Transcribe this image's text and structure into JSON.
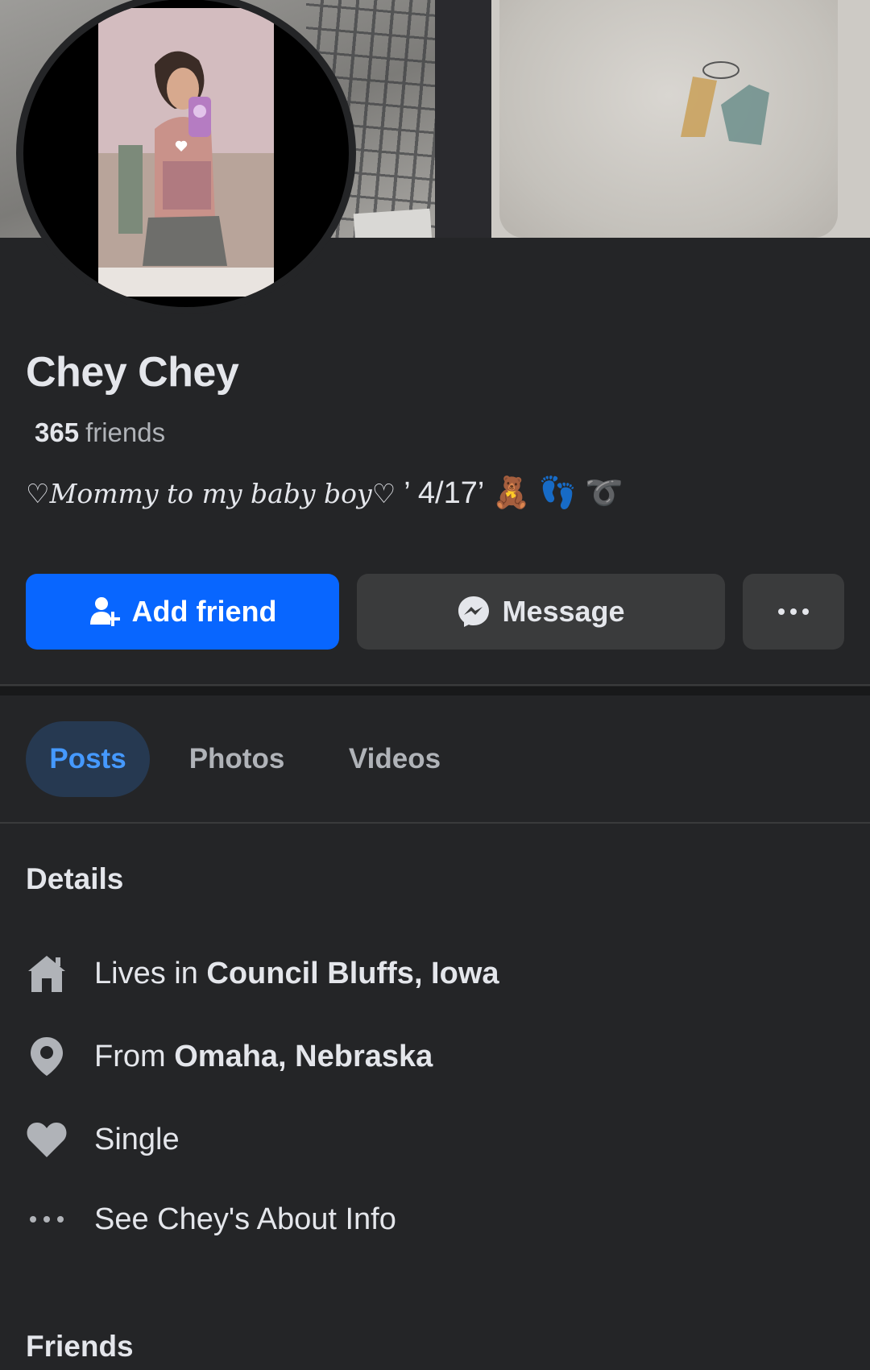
{
  "profile": {
    "name": "Chey Chey",
    "friends_count": "365",
    "friends_label": "friends",
    "bio_script": "♡Mommy to my baby boy♡",
    "bio_date": "’ 4/17’",
    "bio_emojis": [
      "🧸",
      "👣",
      "➰"
    ]
  },
  "actions": {
    "add_friend": "Add friend",
    "message": "Message",
    "more": "···"
  },
  "tabs": [
    {
      "label": "Posts",
      "active": true
    },
    {
      "label": "Photos",
      "active": false
    },
    {
      "label": "Videos",
      "active": false
    }
  ],
  "details": {
    "title": "Details",
    "items": [
      {
        "icon": "home-icon",
        "prefix": "Lives in ",
        "value": "Council Bluffs, Iowa"
      },
      {
        "icon": "location-pin-icon",
        "prefix": "From ",
        "value": "Omaha, Nebraska"
      },
      {
        "icon": "heart-icon",
        "prefix": "",
        "value": "Single"
      },
      {
        "icon": "more-dots-icon",
        "prefix": "",
        "value": "See Chey's About Info"
      }
    ]
  },
  "friends_section": {
    "title": "Friends"
  },
  "colors": {
    "background": "#242527",
    "primary_button": "#0866ff",
    "secondary_button": "#3a3b3c",
    "active_tab_bg": "#263951",
    "active_tab_text": "#4599ff"
  }
}
